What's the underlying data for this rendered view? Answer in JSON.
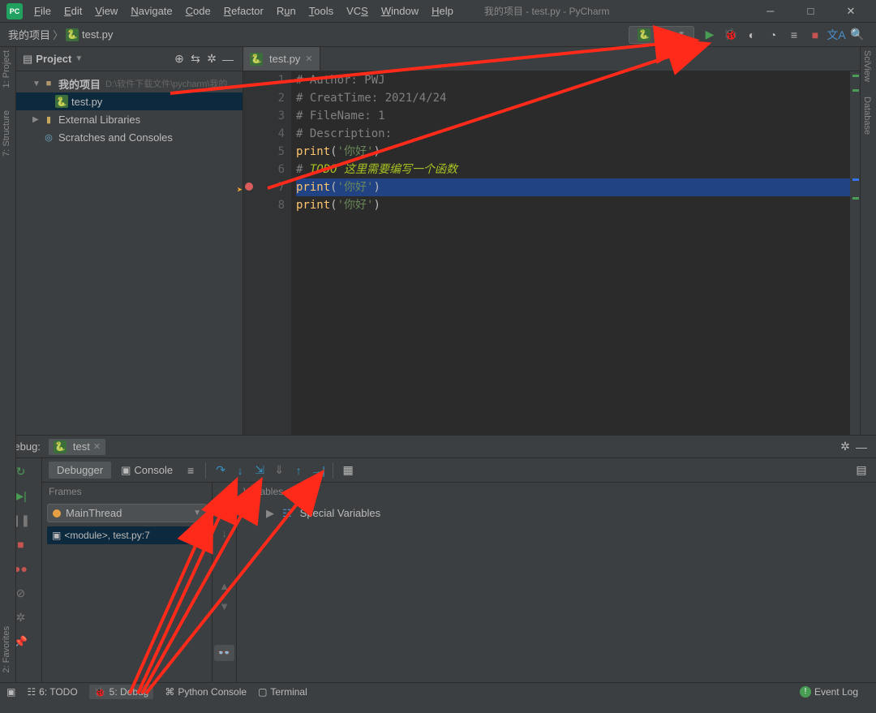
{
  "title": "我的项目 - test.py - PyCharm",
  "menu": [
    "File",
    "Edit",
    "View",
    "Navigate",
    "Code",
    "Refactor",
    "Run",
    "Tools",
    "VCS",
    "Window",
    "Help"
  ],
  "breadcrumb": {
    "project": "我的项目",
    "file": "test.py"
  },
  "run_config": "test",
  "left_rail": [
    "1: Project",
    "7: Structure"
  ],
  "right_rail": [
    "SciView",
    "Database"
  ],
  "bottom_rail": [
    "2: Favorites"
  ],
  "project_panel": {
    "title": "Project",
    "root": {
      "name": "我的项目",
      "path": "D:\\软件下载文件\\pycharm\\我的"
    },
    "file": "test.py",
    "external": "External Libraries",
    "scratches": "Scratches and Consoles"
  },
  "editor": {
    "tab": "test.py",
    "lines": [
      {
        "n": 1,
        "t": "comment",
        "text": "# Author: PWJ"
      },
      {
        "n": 2,
        "t": "comment",
        "text": "# CreatTime: 2021/4/24"
      },
      {
        "n": 3,
        "t": "comment",
        "text": "# FileName: 1"
      },
      {
        "n": 4,
        "t": "comment",
        "text": "# Description:"
      },
      {
        "n": 5,
        "t": "code",
        "pre": "print",
        "str": "'你好'"
      },
      {
        "n": 6,
        "t": "todo",
        "cm": "# ",
        "todo": "TODO",
        "rest": " 这里需要编写一个函数"
      },
      {
        "n": 7,
        "t": "code",
        "pre": "print",
        "str": "'你好'",
        "bp": true,
        "hl": true
      },
      {
        "n": 8,
        "t": "code",
        "pre": "print",
        "str": "'你好'"
      }
    ]
  },
  "debug": {
    "title": "Debug:",
    "config": "test",
    "tabs": {
      "debugger": "Debugger",
      "console": "Console"
    },
    "frames_label": "Frames",
    "vars_label": "Variables",
    "thread": "MainThread",
    "frame": "<module>, test.py:7",
    "special": "Special Variables"
  },
  "status": {
    "todo": "6: TODO",
    "debug": "5: Debug",
    "py_console": "Python Console",
    "terminal": "Terminal",
    "event_log": "Event Log"
  }
}
